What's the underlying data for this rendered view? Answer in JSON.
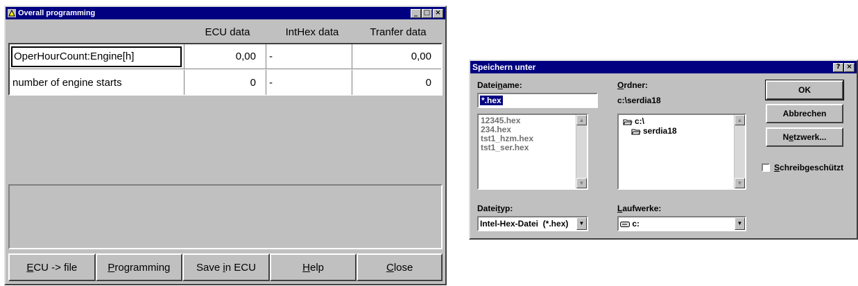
{
  "window1": {
    "title": "Overall programming",
    "columns": [
      "ECU data",
      "IntHex data",
      "Tranfer data"
    ],
    "rows": [
      {
        "name": "OperHourCount:Engine[h]",
        "ecu": "0,00",
        "inthex": "-",
        "transfer": "0,00"
      },
      {
        "name": "number of engine starts",
        "ecu": "0",
        "inthex": "-",
        "transfer": "0"
      }
    ],
    "buttons": {
      "ecu_file": {
        "pre": "",
        "ul": "E",
        "post": "CU -> file"
      },
      "programming": {
        "pre": "",
        "ul": "P",
        "post": "rogramming"
      },
      "save": {
        "pre": "Save ",
        "ul": "i",
        "post": "n ECU"
      },
      "help": {
        "pre": "",
        "ul": "H",
        "post": "elp"
      },
      "close": {
        "pre": "",
        "ul": "C",
        "post": "lose"
      }
    },
    "titlebar_buttons": [
      "_",
      "□",
      "×"
    ]
  },
  "window2": {
    "title": "Speichern unter",
    "titlebar_buttons": [
      "?",
      "×"
    ],
    "filename_label": {
      "pre": "Datei",
      "ul": "n",
      "post": "ame:"
    },
    "filename_value": "*.hex",
    "file_list": [
      "12345.hex",
      "234.hex",
      "tst1_hzm.hex",
      "tst1_ser.hex"
    ],
    "folder_label": {
      "pre": "",
      "ul": "O",
      "post": "rdner:"
    },
    "folder_path": "c:\\serdia18",
    "dir_list": [
      "c:\\",
      "serdia18"
    ],
    "filetype_label": {
      "pre": "Datei",
      "ul": "t",
      "post": "yp:"
    },
    "filetype_value": "Intel-Hex-Datei  (*.hex)",
    "drives_label": {
      "pre": "",
      "ul": "L",
      "post": "aufwerke:"
    },
    "drive_value": "c:",
    "ok_label": "OK",
    "cancel_label": "Abbrechen",
    "network_label": {
      "pre": "N",
      "ul": "e",
      "post": "tzwerk..."
    },
    "readonly_label": {
      "pre": "",
      "ul": "S",
      "post": "chreibgeschützt"
    }
  }
}
